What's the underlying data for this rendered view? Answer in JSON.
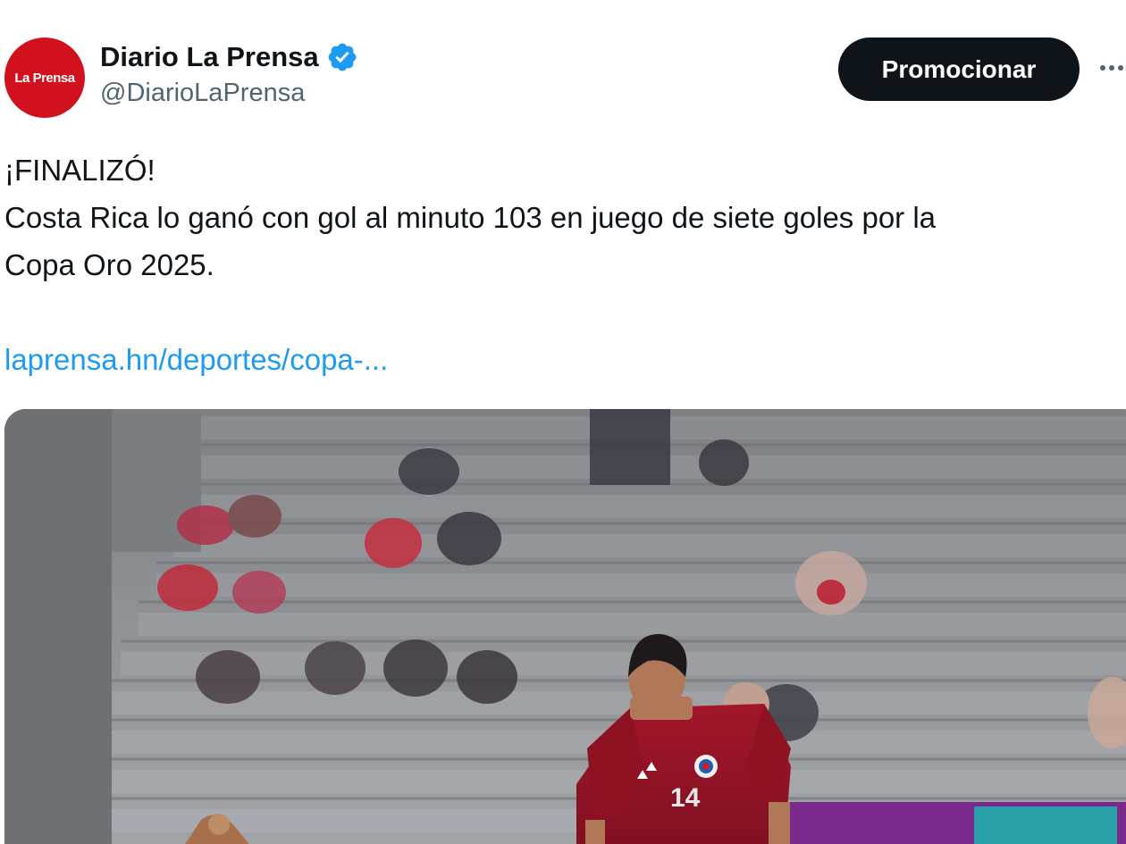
{
  "author": {
    "display_name": "Diario La Prensa",
    "handle": "@DiarioLaPrensa",
    "avatar_text": "La Prensa",
    "verified_icon": "verified-badge-icon",
    "avatar_color": "#d1121e",
    "verified_color": "#1d9bf0"
  },
  "actions": {
    "promote_label": "Promocionar",
    "more_label": "···"
  },
  "post": {
    "headline": "¡FINALIZÓ!",
    "line1": "Costa Rica lo ganó con gol al minuto 103 en juego de siete goles por la",
    "line2": "Copa Oro 2025.",
    "link_text": "laprensa.hn/deportes/copa-..."
  },
  "media": {
    "player_number": "14"
  }
}
